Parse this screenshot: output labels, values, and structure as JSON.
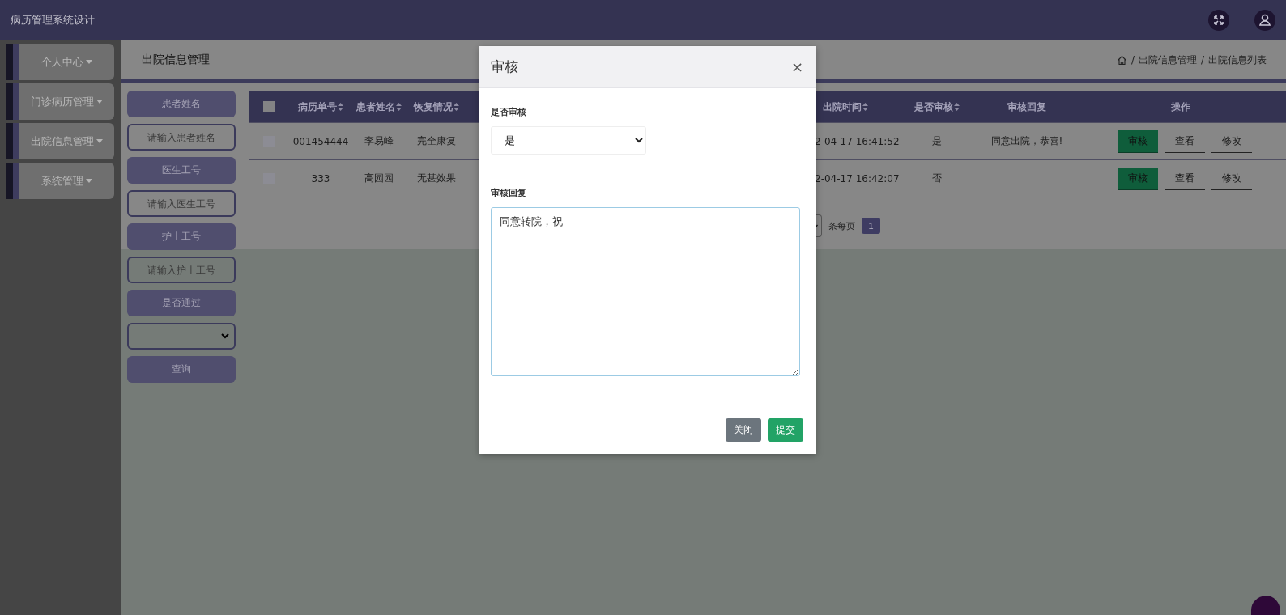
{
  "app": {
    "title": "病历管理系统设计"
  },
  "sidebar": {
    "items": [
      {
        "label": "个人中心"
      },
      {
        "label": "门诊病历管理"
      },
      {
        "label": "出院信息管理"
      },
      {
        "label": "系统管理"
      }
    ]
  },
  "page": {
    "title": "出院信息管理",
    "breadcrumb": {
      "separator": "/",
      "items": [
        "出院信息管理",
        "出院信息列表"
      ]
    }
  },
  "filters": [
    {
      "kind": "label",
      "text": "患者姓名"
    },
    {
      "kind": "input",
      "placeholder": "请输入患者姓名"
    },
    {
      "kind": "label",
      "text": "医生工号"
    },
    {
      "kind": "input",
      "placeholder": "请输入医生工号"
    },
    {
      "kind": "label",
      "text": "护士工号"
    },
    {
      "kind": "input",
      "placeholder": "请输入护士工号"
    },
    {
      "kind": "label",
      "text": "是否通过"
    },
    {
      "kind": "select"
    },
    {
      "kind": "button",
      "text": "查询"
    }
  ],
  "table": {
    "select_all": {
      "checked": false
    },
    "columns": [
      {
        "label": "病历单号",
        "sortable": true
      },
      {
        "label": "患者姓名",
        "sortable": true
      },
      {
        "label": "恢复情况",
        "sortable": true
      },
      {
        "label": "出院时间",
        "sortable": true
      },
      {
        "label": "是否审核",
        "sortable": true
      },
      {
        "label": "审核回复",
        "sortable": false
      },
      {
        "label": "操作",
        "sortable": false
      }
    ],
    "rows": [
      {
        "checked": false,
        "cells": [
          "001454444",
          "李易峰",
          "完全康复",
          "2-04-17 16:41:52",
          "是",
          "同意出院，恭喜!"
        ],
        "actions": [
          "审核",
          "查看",
          "修改"
        ]
      },
      {
        "checked": false,
        "cells": [
          "333",
          "高园园",
          "无甚效果",
          "2-04-17 16:42:07",
          "否",
          ""
        ],
        "actions": [
          "审核",
          "查看",
          "修改"
        ]
      }
    ]
  },
  "pagination": {
    "per_page_label": "条每页",
    "pages": [
      {
        "label": "1",
        "selected": true
      }
    ]
  },
  "modal": {
    "title": "审核",
    "close": "×",
    "fields": [
      {
        "kind": "select",
        "label": "是否审核",
        "value": "是"
      },
      {
        "kind": "textarea",
        "label": "审核回复",
        "value": "同意转院，祝"
      }
    ],
    "buttons": [
      {
        "label": "关闭",
        "kind": "secondary"
      },
      {
        "label": "提交",
        "kind": "primary"
      }
    ]
  }
}
